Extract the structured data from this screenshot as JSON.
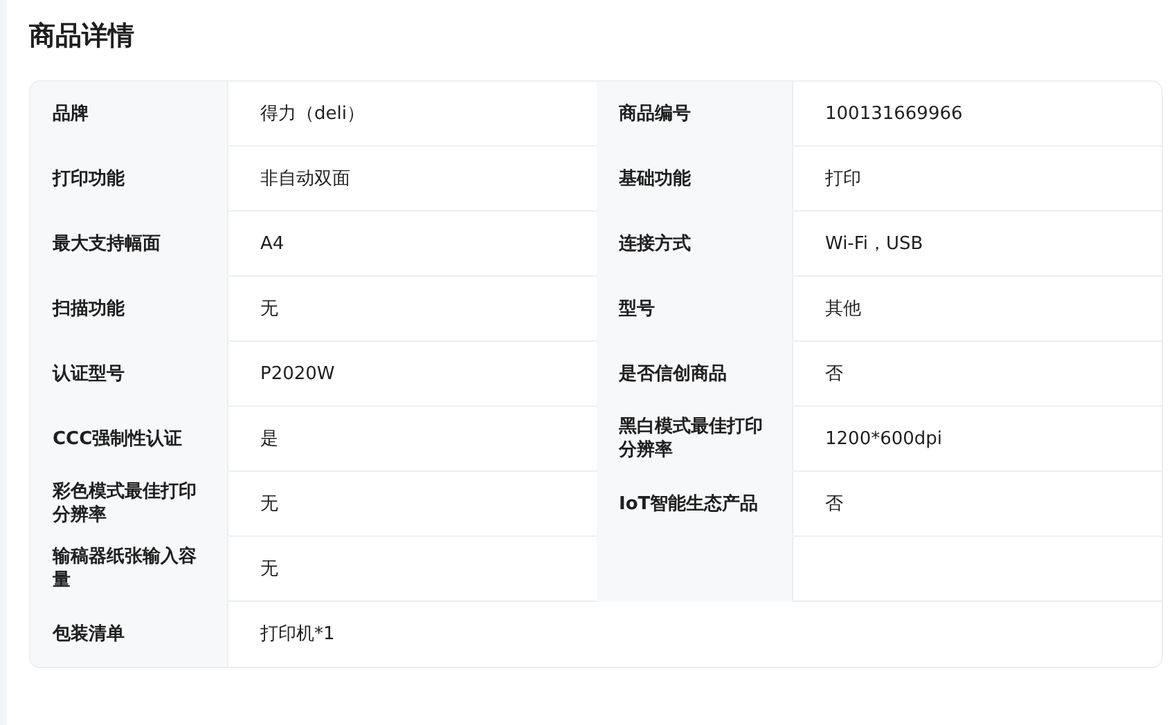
{
  "title": "商品详情",
  "rows": [
    {
      "kind": "pair",
      "cells": [
        {
          "label": "品牌",
          "value": "得力（deli）"
        },
        {
          "label": "商品编号",
          "value": "100131669966"
        }
      ]
    },
    {
      "kind": "pair",
      "cells": [
        {
          "label": "打印功能",
          "value": "非自动双面"
        },
        {
          "label": "基础功能",
          "value": "打印"
        }
      ]
    },
    {
      "kind": "pair",
      "cells": [
        {
          "label": "最大支持幅面",
          "value": "A4"
        },
        {
          "label": "连接方式",
          "value": "Wi-Fi，USB"
        }
      ]
    },
    {
      "kind": "pair",
      "cells": [
        {
          "label": "扫描功能",
          "value": "无"
        },
        {
          "label": "型号",
          "value": "其他"
        }
      ]
    },
    {
      "kind": "pair",
      "cells": [
        {
          "label": "认证型号",
          "value": "P2020W"
        },
        {
          "label": "是否信创商品",
          "value": "否"
        }
      ]
    },
    {
      "kind": "pair",
      "cells": [
        {
          "label": "CCC强制性认证",
          "value": "是"
        },
        {
          "label": "黑白模式最佳打印分辨率",
          "value": "1200*600dpi"
        }
      ]
    },
    {
      "kind": "pair",
      "cells": [
        {
          "label": "彩色模式最佳打印分辨率",
          "value": "无"
        },
        {
          "label": "IoT智能生态产品",
          "value": "否"
        }
      ]
    },
    {
      "kind": "half",
      "cells": [
        {
          "label": "输稿器纸张输入容量",
          "value": "无"
        }
      ]
    },
    {
      "kind": "full",
      "cells": [
        {
          "label": "包装清单",
          "value": "打印机*1"
        }
      ]
    }
  ]
}
